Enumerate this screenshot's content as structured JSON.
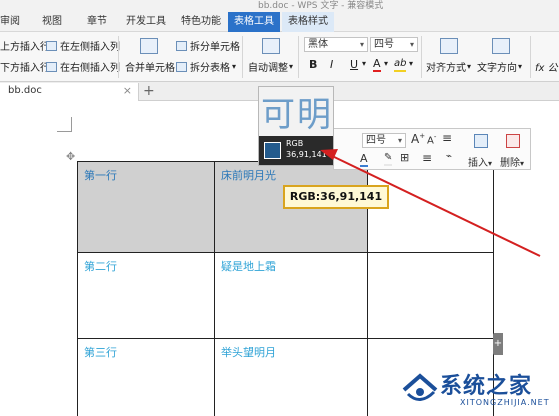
{
  "window": {
    "title": "bb.doc - WPS 文字 - 兼容模式"
  },
  "menu": {
    "tabs": [
      "审阅",
      "视图",
      "章节",
      "开发工具",
      "特色功能",
      "表格工具",
      "表格样式"
    ],
    "active_tab": "表格工具"
  },
  "ribbon": {
    "insert_above": "上方插入行",
    "insert_left": "在左侧插入列",
    "insert_below": "下方插入行",
    "insert_right": "在右侧插入列",
    "merge_cells": "合并单元格",
    "split_cells": "拆分单元格",
    "split_table": "拆分表格",
    "auto_fit": "自动调整",
    "font_name": "黑体",
    "font_size": "四号",
    "bold": "B",
    "italic": "I",
    "underline": "U",
    "font_color": "A",
    "highlight": "ab",
    "alignment": "对齐方式",
    "text_direction": "文字方向",
    "formula": "fx 公"
  },
  "doc": {
    "tab_name": "bb.doc",
    "close_glyph": "×",
    "add_glyph": "+"
  },
  "mini_toolbar": {
    "size": "四号",
    "insert": "插入",
    "delete": "删除"
  },
  "magnifier": {
    "preview_text": "可明",
    "label": "RGB",
    "value": "36,91,141",
    "swatch_color": "#245b8d"
  },
  "callout": {
    "text": "RGB:36,91,141"
  },
  "table": {
    "rows": [
      [
        "第一行",
        "床前明月光",
        ""
      ],
      [
        "第二行",
        "疑是地上霜",
        ""
      ],
      [
        "第三行",
        "举头望明月",
        ""
      ]
    ]
  },
  "watermark": {
    "cn": "系统之家",
    "en": "XITONGZHIJIA.NET"
  },
  "side_handle": "+",
  "colors": {
    "accent": "#2b72c9",
    "arrow": "#d42020",
    "text_blue": "#2fa3d6"
  }
}
